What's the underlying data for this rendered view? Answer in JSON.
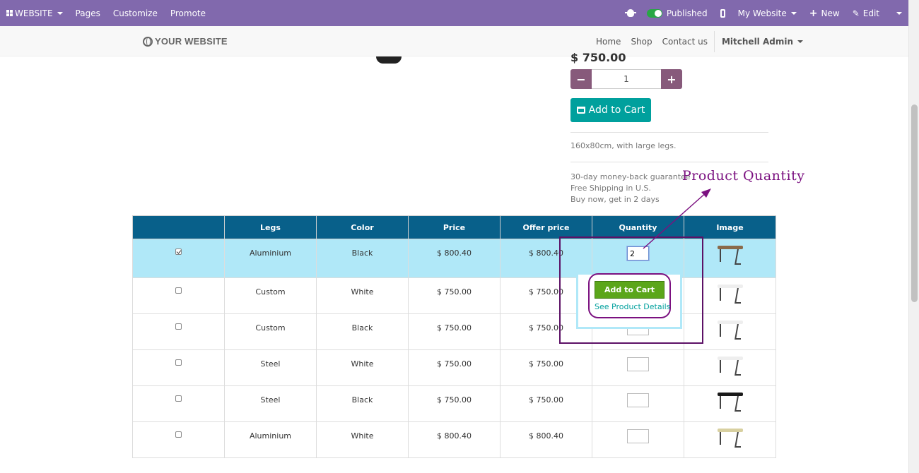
{
  "admin_bar": {
    "website_label": "WEBSITE",
    "pages_label": "Pages",
    "customize_label": "Customize",
    "promote_label": "Promote",
    "published_label": "Published",
    "my_website_label": "My Website",
    "new_label": "New",
    "edit_label": "Edit"
  },
  "site_nav": {
    "logo_text": "YOUR WEBSITE",
    "links": [
      "Home",
      "Shop",
      "Contact us"
    ],
    "user": "Mitchell Admin"
  },
  "product": {
    "price": "$ 750.00",
    "quantity": "1",
    "add_to_cart_label": "Add to Cart",
    "description": "160x80cm, with large legs.",
    "info_lines": [
      "30-day money-back guarantee",
      "Free Shipping in U.S.",
      "Buy now, get in 2 days"
    ]
  },
  "annotation": {
    "text": "Product  Quantity",
    "color": "#7b1180"
  },
  "variants_table": {
    "headers": [
      "",
      "Legs",
      "Color",
      "Price",
      "Offer price",
      "Quantity",
      "Image"
    ],
    "rows": [
      {
        "checked": true,
        "legs": "Aluminium",
        "color": "Black",
        "price": "$ 800.40",
        "offer": "$ 800.40",
        "qty": "2",
        "desk_color": "#8a6a4a"
      },
      {
        "checked": false,
        "legs": "Custom",
        "color": "White",
        "price": "$ 750.00",
        "offer": "$ 750.00",
        "qty": "",
        "desk_color": "#eeeeee"
      },
      {
        "checked": false,
        "legs": "Custom",
        "color": "Black",
        "price": "$ 750.00",
        "offer": "$ 750.00",
        "qty": "",
        "desk_color": "#eeeeee"
      },
      {
        "checked": false,
        "legs": "Steel",
        "color": "White",
        "price": "$ 750.00",
        "offer": "$ 750.00",
        "qty": "",
        "desk_color": "#eeeeee"
      },
      {
        "checked": false,
        "legs": "Steel",
        "color": "Black",
        "price": "$ 750.00",
        "offer": "$ 750.00",
        "qty": "",
        "desk_color": "#1a1a1a"
      },
      {
        "checked": false,
        "legs": "Aluminium",
        "color": "White",
        "price": "$ 800.40",
        "offer": "$ 800.40",
        "qty": "",
        "desk_color": "#d8d0a0"
      }
    ]
  },
  "popup": {
    "add_to_cart_label": "Add to Cart",
    "details_link": "See Product Details"
  },
  "colors": {
    "admin_bar": "#8169ad",
    "table_header": "#08608a",
    "selected_row": "#b0e8f8",
    "primary_button": "#00a09d",
    "qty_button": "#875a7b",
    "popup_button": "#5ba61a"
  }
}
